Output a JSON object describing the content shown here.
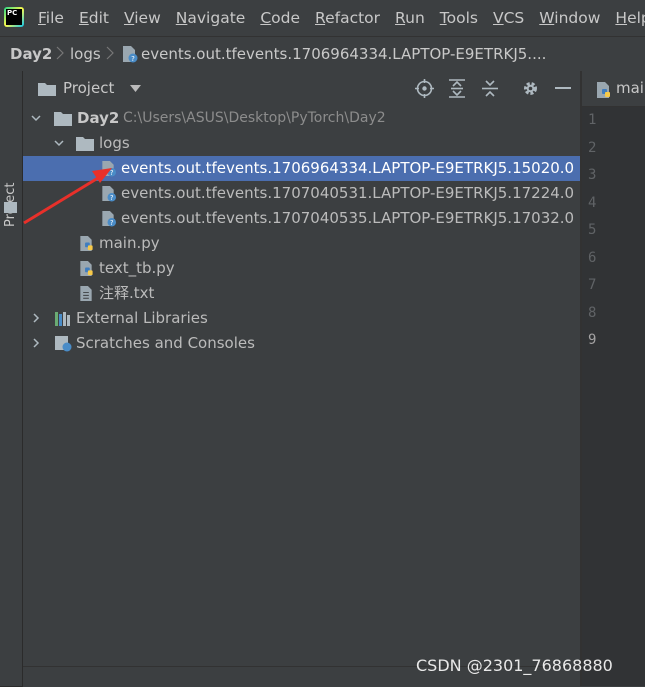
{
  "menubar": {
    "logo_text": "PC",
    "items": [
      "File",
      "Edit",
      "View",
      "Navigate",
      "Code",
      "Refactor",
      "Run",
      "Tools",
      "VCS",
      "Window",
      "Help"
    ]
  },
  "navbar": {
    "crumbs": [
      "Day2",
      "logs",
      "events.out.tfevents.1706964334.LAPTOP-E9ETRKJ5...."
    ]
  },
  "sidebar": {
    "label": "Project"
  },
  "panel": {
    "title": "Project",
    "icons": [
      "locate-icon",
      "expand-all-icon",
      "collapse-all-icon",
      "gear-icon",
      "minimize-icon"
    ]
  },
  "tree": {
    "root": {
      "name": "Day2",
      "path": "C:\\Users\\ASUS\\Desktop\\PyTorch\\Day2"
    },
    "logs_folder": "logs",
    "event_files": [
      "events.out.tfevents.1706964334.LAPTOP-E9ETRKJ5.15020.0",
      "events.out.tfevents.1707040531.LAPTOP-E9ETRKJ5.17224.0",
      "events.out.tfevents.1707040535.LAPTOP-E9ETRKJ5.17032.0"
    ],
    "files": [
      "main.py",
      "text_tb.py",
      "注释.txt"
    ],
    "external_libraries": "External Libraries",
    "scratches": "Scratches and Consoles"
  },
  "editor": {
    "tab_label": "main",
    "line_numbers": [
      "1",
      "2",
      "3",
      "4",
      "5",
      "6",
      "7",
      "8",
      "9"
    ],
    "current_line": "9"
  },
  "watermark": "CSDN @2301_76868880",
  "colors": {
    "selection": "#4b6eaf",
    "panel_bg": "#3c3f41",
    "editor_bg": "#2b2b2b",
    "annotation_arrow": "#e8302a"
  }
}
